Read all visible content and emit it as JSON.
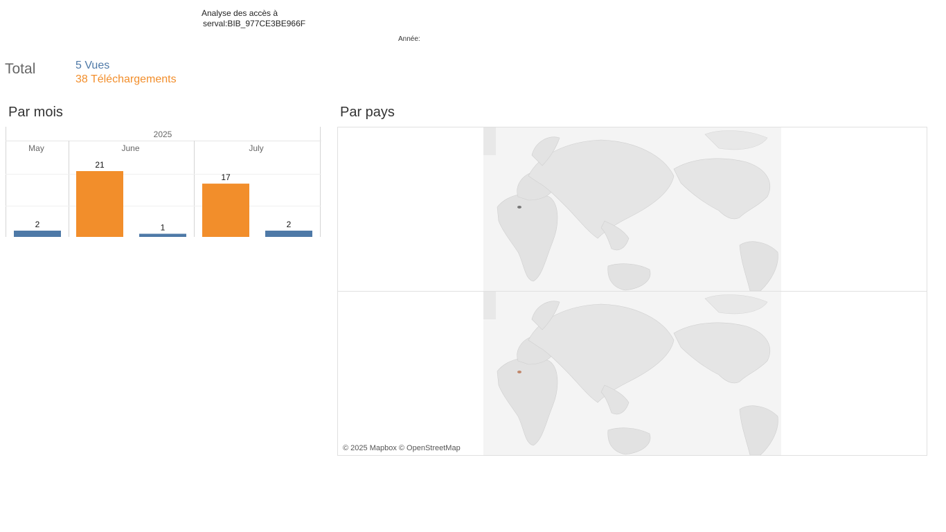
{
  "header": {
    "title_line1": "Analyse des accès à",
    "title_line2": "serval:BIB_977CE3BE966F",
    "year_filter_label": "Année:"
  },
  "totals": {
    "label": "Total",
    "views": "5 Vues",
    "downloads": "38 Téléchargements"
  },
  "sections": {
    "monthly": "Par mois",
    "countries": "Par pays"
  },
  "colors": {
    "views": "#4e79a7",
    "downloads": "#f28e2b"
  },
  "chart_data": {
    "type": "bar",
    "year": "2025",
    "months": [
      "May",
      "June",
      "July"
    ],
    "series": [
      {
        "key": "downloads",
        "values": [
          null,
          21,
          17
        ]
      },
      {
        "key": "views",
        "values": [
          2,
          1,
          2
        ]
      }
    ],
    "ylim": [
      0,
      21
    ]
  },
  "map": {
    "attribution": "© 2025 Mapbox © OpenStreetMap",
    "panels": [
      {
        "highlight_color": "#777777"
      },
      {
        "highlight_color": "#c0866a"
      }
    ]
  }
}
